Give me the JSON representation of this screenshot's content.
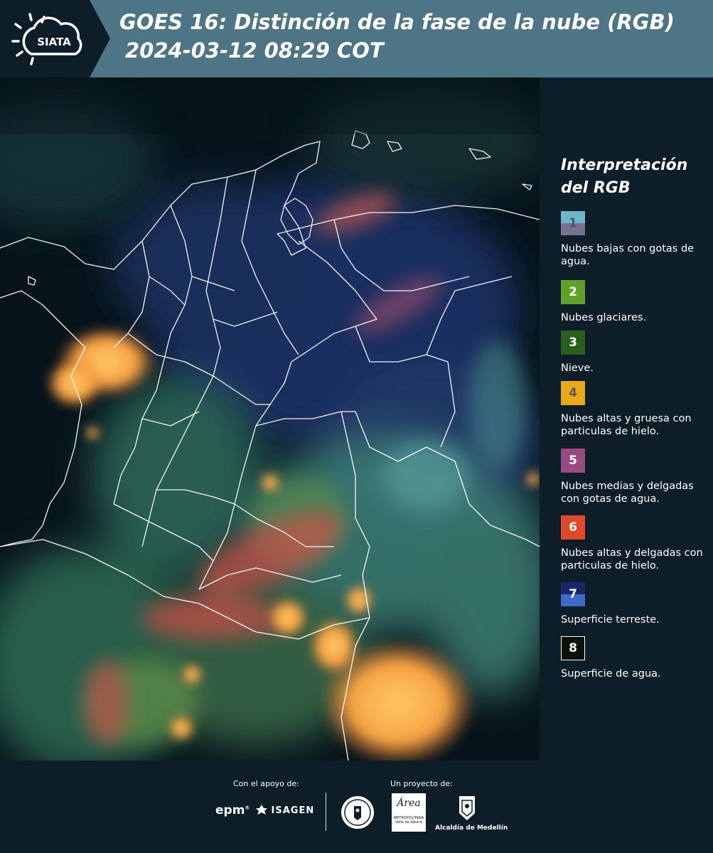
{
  "header": {
    "logo_text": "SIATA",
    "title_line1": "GOES 16: Distinción de la fase de la nube (RGB)",
    "title_line2": "2024-03-12 08:29 COT"
  },
  "legend": {
    "title_line1": "Interpretación",
    "title_line2": "del RGB",
    "items": [
      {
        "number": "1",
        "label": "Nubes bajas con gotas de agua.",
        "color_top": "#6ab8c8",
        "color_bottom": "#7a7090",
        "text_color": "#555555"
      },
      {
        "number": "2",
        "label": "Nubes glaciares.",
        "color_top": "#5ea22c",
        "color_bottom": "#5ea22c",
        "text_color": "#ffffff"
      },
      {
        "number": "3",
        "label": "Nieve.",
        "color_top": "#2a5e1c",
        "color_bottom": "#2a5e1c",
        "text_color": "#ffffff"
      },
      {
        "number": "4",
        "label": "Nubes altas y gruesa con particulas de hielo.",
        "color_top": "#e8aa18",
        "color_bottom": "#e8aa18",
        "text_color": "#5a5a5a"
      },
      {
        "number": "5",
        "label": "Nubes medias y delgadas con gotas de agua.",
        "color_top": "#9a4a80",
        "color_bottom": "#9a4a80",
        "text_color": "#ffffff"
      },
      {
        "number": "6",
        "label": "Nubes altas y delgadas con particulas de hielo.",
        "color_top": "#e04a28",
        "color_bottom": "#e04a28",
        "text_color": "#ffffff"
      },
      {
        "number": "7",
        "label": "Superficie terreste.",
        "color_top": "#14286a",
        "color_bottom": "#3e6ac8",
        "text_color": "#ffffff"
      },
      {
        "number": "8",
        "label": "Superficie de agua.",
        "color_top": "#0a120a",
        "color_bottom": "#0a120a",
        "text_color": "#ffffff"
      }
    ]
  },
  "footer": {
    "support_caption": "Con el apoyo de:",
    "project_caption": "Un proyecto de:",
    "sponsors": {
      "epm": "epm",
      "isagen": "ISAGEN",
      "area_name": "Área",
      "area_sub1": "METROPOLITANA",
      "area_sub2": "Valle de Aburrá",
      "alcaldia": "Alcaldía de Medellín"
    }
  },
  "colors": {
    "header_bg": "#4d7585",
    "page_bg": "#0d1e28",
    "map_ocean": "#07141b",
    "cloud_orange": "#f7a443"
  }
}
